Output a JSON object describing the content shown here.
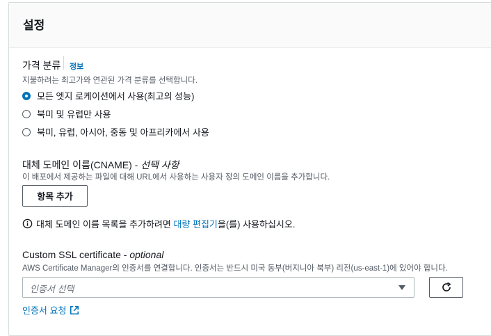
{
  "panel": {
    "title": "설정"
  },
  "price_class": {
    "label": "가격 분류",
    "info_link": "정보",
    "description": "지불하려는 최고가와 연관된 가격 분류를 선택합니다.",
    "options": [
      {
        "label": "모든 엣지 로케이션에서 사용(최고의 성능)",
        "checked": true
      },
      {
        "label": "북미 및 유럽만 사용",
        "checked": false
      },
      {
        "label": "북미, 유럽, 아시아, 중동 및 아프리카에서 사용",
        "checked": false
      }
    ]
  },
  "cname": {
    "label_main": "대체 도메인 이름(CNAME) - ",
    "label_optional": "선택 사항",
    "description": "이 배포에서 제공하는 파일에 대해 URL에서 사용하는 사용자 정의 도메인 이름을 추가합니다.",
    "add_button": "항목 추가",
    "info_text_before": "대체 도메인 이름 목록을 추가하려면 ",
    "info_link": "대량 편집기",
    "info_text_after": "을(를) 사용하십시오."
  },
  "ssl": {
    "label_main": "Custom SSL certificate - ",
    "label_optional": "optional",
    "description": "AWS Certificate Manager의 인증서를 연결합니다. 인증서는 반드시 미국 동부(버지니아 북부) 리전(us-east-1)에 있어야 합니다.",
    "select_placeholder": "인증서 선택",
    "request_link": "인증서 요청"
  },
  "icons": {
    "info": "info-circle-icon",
    "refresh": "refresh-icon",
    "external": "external-link-icon",
    "caret": "caret-down-icon"
  },
  "colors": {
    "accent": "#0073bb",
    "text": "#16191f",
    "muted": "#545b64"
  }
}
